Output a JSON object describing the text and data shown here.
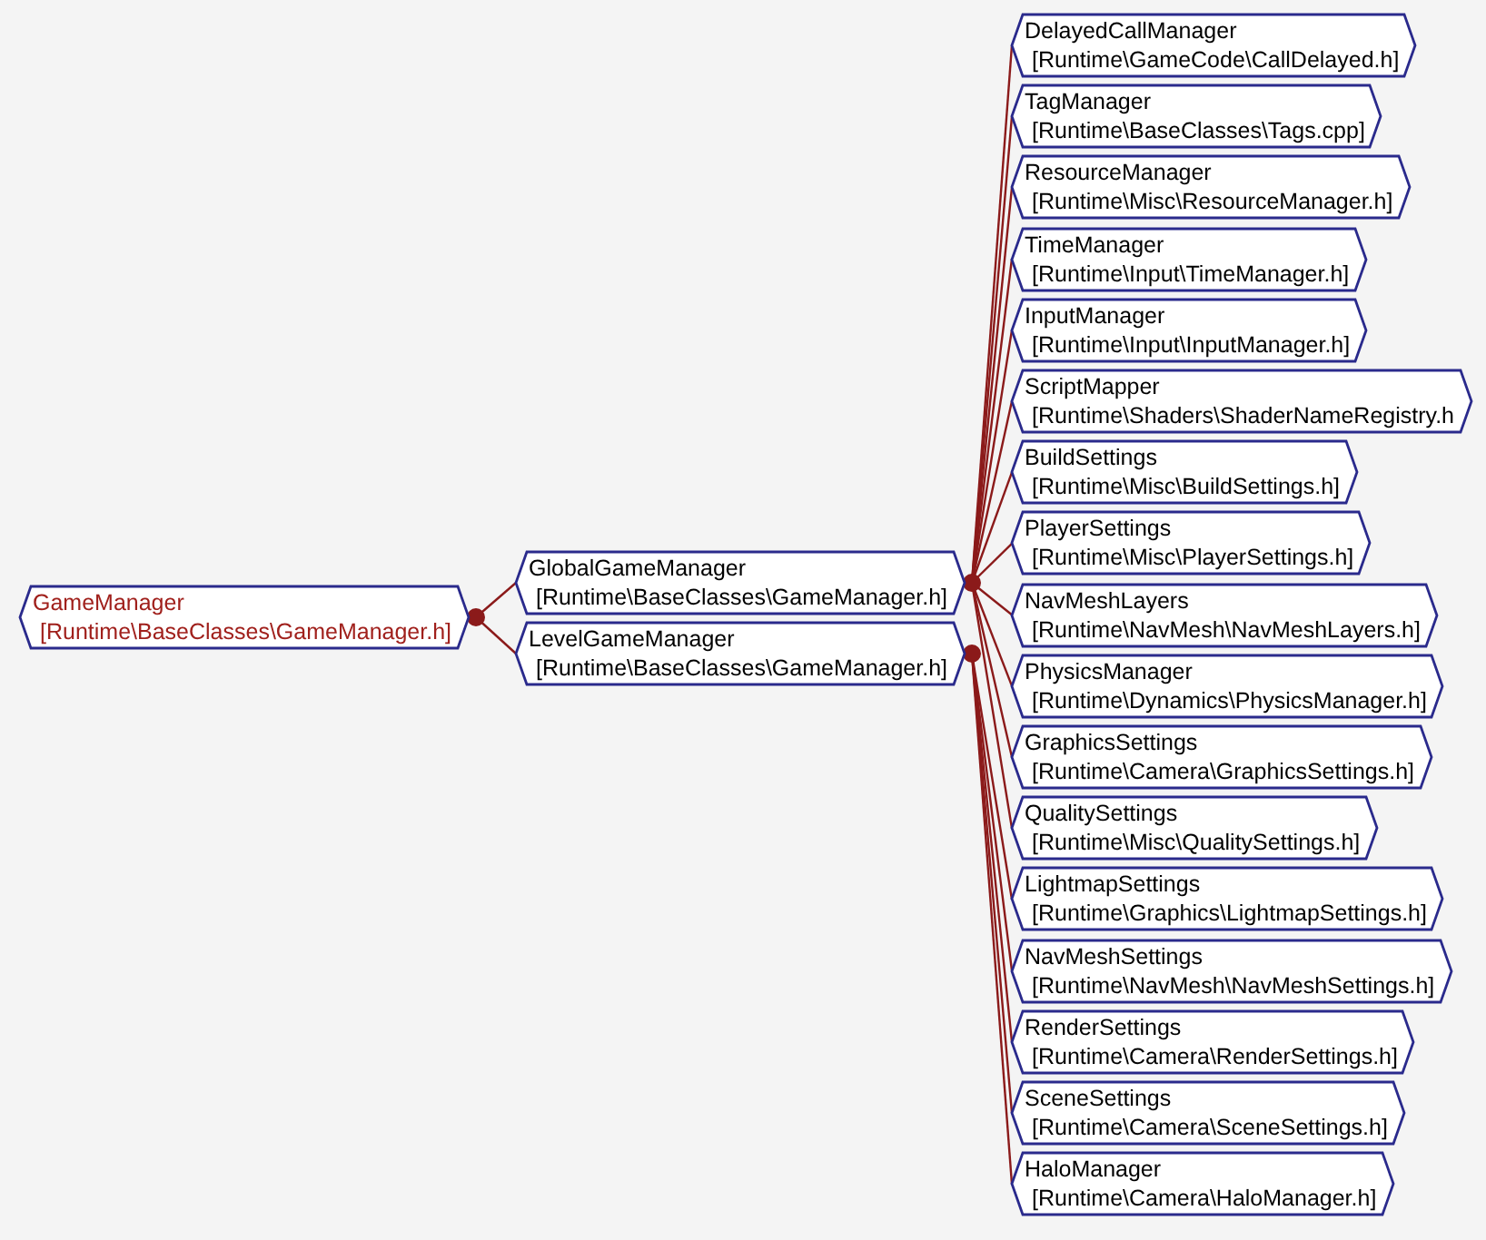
{
  "diagram": {
    "name": "GameManager",
    "file": "[Runtime\\BaseClasses\\GameManager.h]",
    "current": true,
    "children": [
      {
        "name": "GlobalGameManager",
        "file": "[Runtime\\BaseClasses\\GameManager.h]",
        "current": false,
        "children": [
          {
            "name": "DelayedCallManager",
            "file": "[Runtime\\GameCode\\CallDelayed.h]",
            "current": false
          },
          {
            "name": "TagManager",
            "file": "[Runtime\\BaseClasses\\Tags.cpp]",
            "current": false
          },
          {
            "name": "ResourceManager",
            "file": "[Runtime\\Misc\\ResourceManager.h]",
            "current": false
          },
          {
            "name": "TimeManager",
            "file": "[Runtime\\Input\\TimeManager.h]",
            "current": false
          },
          {
            "name": "InputManager",
            "file": "[Runtime\\Input\\InputManager.h]",
            "current": false
          },
          {
            "name": "ScriptMapper",
            "file": "[Runtime\\Shaders\\ShaderNameRegistry.h",
            "current": false
          },
          {
            "name": "BuildSettings",
            "file": "[Runtime\\Misc\\BuildSettings.h]",
            "current": false
          },
          {
            "name": "PlayerSettings",
            "file": "[Runtime\\Misc\\PlayerSettings.h]",
            "current": false
          },
          {
            "name": "NavMeshLayers",
            "file": "[Runtime\\NavMesh\\NavMeshLayers.h]",
            "current": false
          },
          {
            "name": "PhysicsManager",
            "file": "[Runtime\\Dynamics\\PhysicsManager.h]",
            "current": false
          },
          {
            "name": "GraphicsSettings",
            "file": "[Runtime\\Camera\\GraphicsSettings.h]",
            "current": false
          },
          {
            "name": "QualitySettings",
            "file": "[Runtime\\Misc\\QualitySettings.h]",
            "current": false
          }
        ]
      },
      {
        "name": "LevelGameManager",
        "file": "[Runtime\\BaseClasses\\GameManager.h]",
        "current": false,
        "children": [
          {
            "name": "LightmapSettings",
            "file": "[Runtime\\Graphics\\LightmapSettings.h]",
            "current": false
          },
          {
            "name": "NavMeshSettings",
            "file": "[Runtime\\NavMesh\\NavMeshSettings.h]",
            "current": false
          },
          {
            "name": "RenderSettings",
            "file": "[Runtime\\Camera\\RenderSettings.h]",
            "current": false
          },
          {
            "name": "SceneSettings",
            "file": "[Runtime\\Camera\\SceneSettings.h]",
            "current": false
          },
          {
            "name": "HaloManager",
            "file": "[Runtime\\Camera\\HaloManager.h]",
            "current": false
          }
        ]
      }
    ]
  }
}
